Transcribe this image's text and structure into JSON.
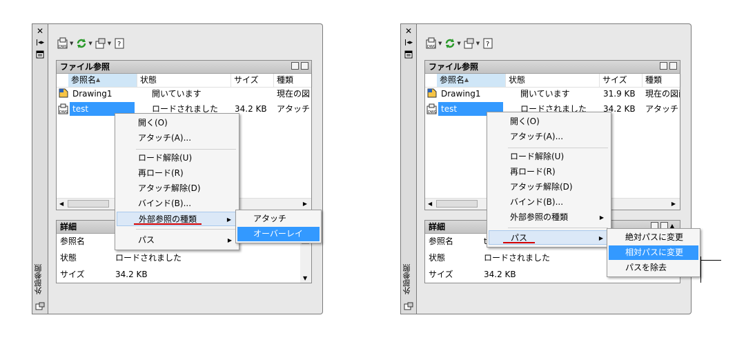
{
  "panel_title": "外部参照",
  "side_buttons": [
    "✕"
  ],
  "files_header": "ファイル参照",
  "columns": [
    "参照名",
    "状態",
    "サイズ",
    "種類"
  ],
  "details_header": "詳細",
  "details_labels": [
    "参照名",
    "状態",
    "サイズ"
  ],
  "details_values": [
    "",
    "ロードされました",
    "34.2 KB"
  ],
  "left": {
    "rows": [
      {
        "name": "Drawing1",
        "status": "開いています",
        "size": "",
        "type": "現在の図"
      },
      {
        "name": "test",
        "status": "ロードされました",
        "size": "34.2 KB",
        "type": "アタッチ"
      }
    ],
    "menu": [
      "開く(O)",
      "アタッチ(A)...",
      "ロード解除(U)",
      "再ロード(R)",
      "アタッチ解除(D)",
      "バインド(B)...",
      "外部参照の種類",
      "パス"
    ],
    "submenu": [
      "アタッチ",
      "オーバーレイ"
    ]
  },
  "right": {
    "rows": [
      {
        "name": "Drawing1",
        "status": "開いています",
        "size": "31.9 KB",
        "type": "現在の図面"
      },
      {
        "name": "test",
        "status": "ロードされました",
        "size": "34.2 KB",
        "type": "アタッチ"
      }
    ],
    "details_name_partial": "t",
    "menu": [
      "開く(O)",
      "アタッチ(A)...",
      "ロード解除(U)",
      "再ロード(R)",
      "アタッチ解除(D)",
      "バインド(B)...",
      "外部参照の種類",
      "パス"
    ],
    "submenu": [
      "絶対パスに変更",
      "相対パスに変更",
      "パスを除去"
    ]
  },
  "colors": {
    "accent": "#3399ff",
    "underline": "#d40000",
    "panel_bg": "#e8e8e8"
  }
}
